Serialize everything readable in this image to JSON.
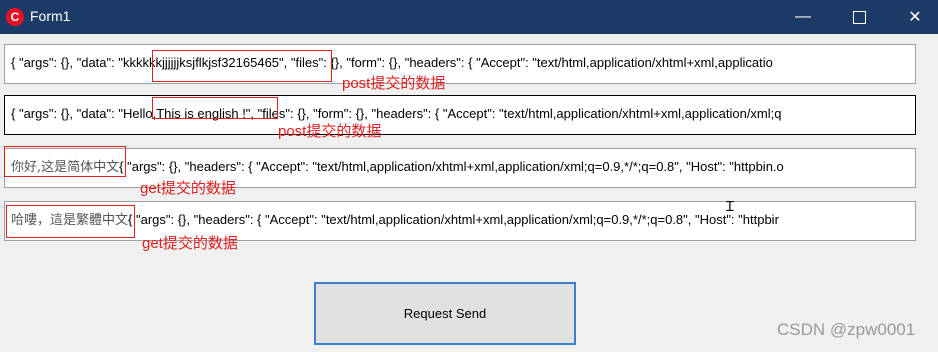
{
  "window": {
    "title": "Form1",
    "app_icon_letter": "C",
    "minimize_glyph": "—",
    "close_glyph": "✕"
  },
  "rows": [
    {
      "text": "{  \"args\": {},   \"data\": \"kkkkkkjjjjjjksjflkjsf32165465\",   \"files\": {},   \"form\": {},   \"headers\": {    \"Accept\": \"text/html,application/xhtml+xml,applicatio",
      "annotation": "post提交的数据"
    },
    {
      "text": "{  \"args\": {},   \"data\": \"Hello,This is english !\",   \"files\": {},   \"form\": {},   \"headers\": {    \"Accept\": \"text/html,application/xhtml+xml,application/xml;q",
      "annotation": "post提交的数据"
    },
    {
      "prefix": "你好,这是简体中文",
      "text": "{  \"args\": {},   \"headers\": {    \"Accept\": \"text/html,application/xhtml+xml,application/xml;q=0.9,*/*;q=0.8\",     \"Host\": \"httpbin.o",
      "annotation": "get提交的数据"
    },
    {
      "prefix": "哈嘍，這是繁體中文",
      "text": "{  \"args\": {},   \"headers\": {    \"Accept\": \"text/html,application/xhtml+xml,application/xml;q=0.9,*/*;q=0.8\",     \"Host\": \"httpbir",
      "annotation": "get提交的数据"
    }
  ],
  "button": {
    "label": "Request Send"
  },
  "watermark": "CSDN @zpw0001",
  "colors": {
    "titlebar": "#1c3a66",
    "annotation": "#e02020",
    "button_border": "#3c7fd0"
  }
}
